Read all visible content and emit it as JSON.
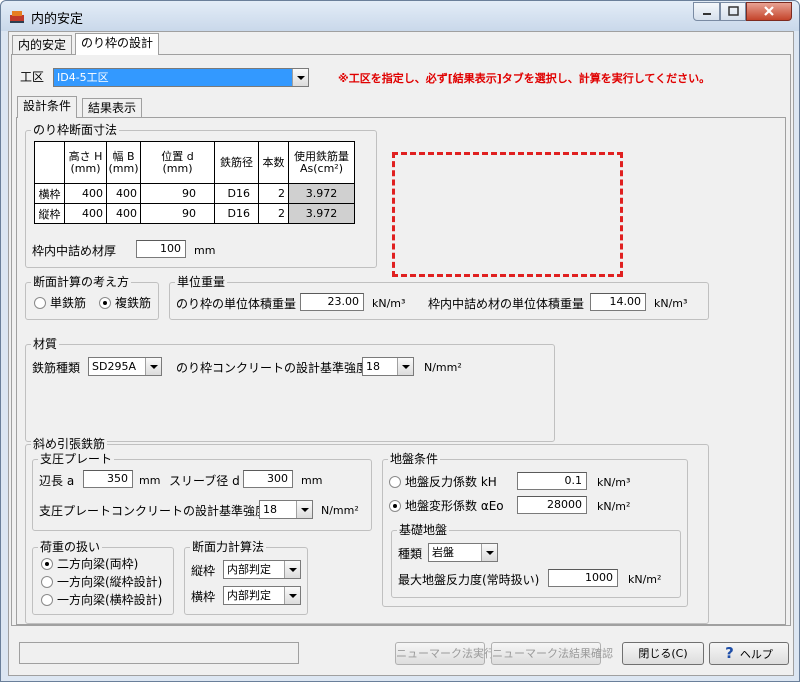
{
  "window": {
    "title": "内的安定"
  },
  "top_tabs": [
    {
      "label": "内的安定"
    },
    {
      "label": "のり枠の設計"
    }
  ],
  "work_area": {
    "label": "工区",
    "selected": "ID4-5工区",
    "warning": "※工区を指定し、必ず[結果表示]タブを選択し、計算を実行してください。"
  },
  "sub_tabs": [
    {
      "label": "設計条件"
    },
    {
      "label": "結果表示"
    }
  ],
  "section_dims": {
    "title": "のり枠断面寸法",
    "headers": {
      "height": "高さ H\n(mm)",
      "width": "幅 B\n(mm)",
      "pos": "位置 d\n(mm)",
      "bar": "鉄筋径",
      "count": "本数",
      "area": "使用鉄筋量\nAs(cm²)"
    },
    "rows": [
      {
        "name": "横枠",
        "height": "400",
        "width": "400",
        "pos": "90",
        "bar": "D16",
        "count": "2",
        "area": "3.972"
      },
      {
        "name": "縦枠",
        "height": "400",
        "width": "400",
        "pos": "90",
        "bar": "D16",
        "count": "2",
        "area": "3.972"
      }
    ],
    "fill_label": "枠内中詰め材厚",
    "fill_value": "100",
    "fill_unit": "mm"
  },
  "calc_method": {
    "title": "断面計算の考え方",
    "single": "単鉄筋",
    "double": "複鉄筋"
  },
  "unit_weight": {
    "title": "単位重量",
    "frame_label": "のり枠の単位体積重量",
    "frame_value": "23.00",
    "frame_unit": "kN/m³",
    "fill_label": "枠内中詰め材の単位体積重量",
    "fill_value": "14.00",
    "fill_unit": "kN/m³"
  },
  "material": {
    "title": "材質",
    "rebar_label": "鉄筋種類",
    "rebar_value": "SD295A",
    "concrete_label": "のり枠コンクリートの設計基準強度",
    "concrete_value": "18",
    "concrete_unit": "N/mm²"
  },
  "tension": {
    "title": "斜め引張鉄筋",
    "plate": {
      "title": "支圧プレート",
      "side_label": "辺長 a",
      "side_value": "350",
      "side_unit": "mm",
      "sleeve_label": "スリーブ径 d",
      "sleeve_value": "300",
      "sleeve_unit": "mm",
      "conc_label": "支圧プレートコンクリートの設計基準強度",
      "conc_value": "18",
      "conc_unit": "N/mm²"
    },
    "load": {
      "title": "荷重の扱い",
      "opt1": "二方向梁(両枠)",
      "opt2": "一方向梁(縦枠設計)",
      "opt3": "一方向梁(横枠設計)"
    },
    "shear": {
      "title": "断面力計算法",
      "vert_label": "縦枠",
      "vert_value": "内部判定",
      "horiz_label": "横枠",
      "horiz_value": "内部判定"
    },
    "ground": {
      "title": "地盤条件",
      "kh_label": "地盤反力係数 kH",
      "kh_value": "0.1",
      "kh_unit": "kN/m³",
      "ae_label": "地盤変形係数 αEo",
      "ae_value": "28000",
      "ae_unit": "kN/m²"
    },
    "foundation": {
      "title": "基礎地盤",
      "type_label": "種類",
      "type_value": "岩盤",
      "max_label": "最大地盤反力度(常時扱い)",
      "max_value": "1000",
      "max_unit": "kN/m²"
    }
  },
  "footer": {
    "run_label": "ニューマーク法実行",
    "check_label": "ニューマーク法結果確認",
    "close_label": "閉じる(C)",
    "help_label": "ヘルプ"
  }
}
